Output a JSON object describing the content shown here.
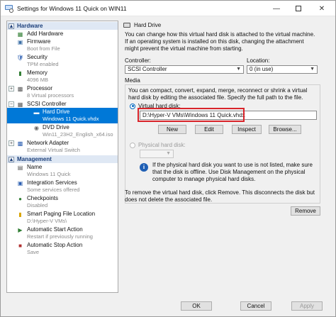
{
  "window": {
    "title": "Settings for Windows 11 Quick on WIN11",
    "minimize_icon": "minimize-icon",
    "maximize_icon": "maximize-icon",
    "close_icon": "close-icon"
  },
  "sidebar": {
    "hardware_header": "Hardware",
    "management_header": "Management",
    "hardware_items": [
      {
        "name": "Add Hardware",
        "detail": "",
        "icon": "add-hardware-icon"
      },
      {
        "name": "Firmware",
        "detail": "Boot from File",
        "icon": "firmware-icon"
      },
      {
        "name": "Security",
        "detail": "TPM enabled",
        "icon": "security-icon"
      },
      {
        "name": "Memory",
        "detail": "4096 MB",
        "icon": "memory-icon"
      },
      {
        "name": "Processor",
        "detail": "8 Virtual processors",
        "icon": "processor-icon"
      },
      {
        "name": "SCSI Controller",
        "detail": "",
        "icon": "scsi-controller-icon"
      },
      {
        "name": "Hard Drive",
        "detail": "Windows 11 Quick.vhdx",
        "icon": "hard-drive-icon"
      },
      {
        "name": "DVD Drive",
        "detail": "Win11_23H2_English_x64.iso",
        "icon": "dvd-drive-icon"
      },
      {
        "name": "Network Adapter",
        "detail": "External Virtual Switch",
        "icon": "network-adapter-icon"
      }
    ],
    "management_items": [
      {
        "name": "Name",
        "detail": "Windows 11 Quick",
        "icon": "name-icon"
      },
      {
        "name": "Integration Services",
        "detail": "Some services offered",
        "icon": "integration-services-icon"
      },
      {
        "name": "Checkpoints",
        "detail": "Disabled",
        "icon": "checkpoints-icon"
      },
      {
        "name": "Smart Paging File Location",
        "detail": "D:\\Hyper-V VMs\\",
        "icon": "folder-icon"
      },
      {
        "name": "Automatic Start Action",
        "detail": "Restart if previously running",
        "icon": "start-action-icon"
      },
      {
        "name": "Automatic Stop Action",
        "detail": "Save",
        "icon": "stop-action-icon"
      }
    ],
    "selected_item": "Hard Drive"
  },
  "panel": {
    "header": "Hard Drive",
    "description": "You can change how this virtual hard disk is attached to the virtual machine. If an operating system is installed on this disk, changing the attachment might prevent the virtual machine from starting.",
    "controller_label": "Controller:",
    "controller_value": "SCSI Controller",
    "location_label": "Location:",
    "location_value": "0 (in use)",
    "media_label": "Media",
    "media_description": "You can compact, convert, expand, merge, reconnect or shrink a virtual hard disk by editing the associated file. Specify the full path to the file.",
    "virtual_disk_label": "Virtual hard disk:",
    "virtual_disk_path": "D:\\Hyper-V VMs\\Windows 11 Quick.vhdx",
    "buttons": {
      "new": "New",
      "edit": "Edit",
      "inspect": "Inspect",
      "browse": "Browse..."
    },
    "physical_disk_label": "Physical hard disk:",
    "physical_disk_note": "If the physical hard disk you want to use is not listed, make sure that the disk is offline. Use Disk Management on the physical computer to manage physical hard disks.",
    "remove_description": "To remove the virtual hard disk, click Remove. This disconnects the disk but does not delete the associated file.",
    "remove_button": "Remove"
  },
  "footer": {
    "ok": "OK",
    "cancel": "Cancel",
    "apply": "Apply"
  }
}
